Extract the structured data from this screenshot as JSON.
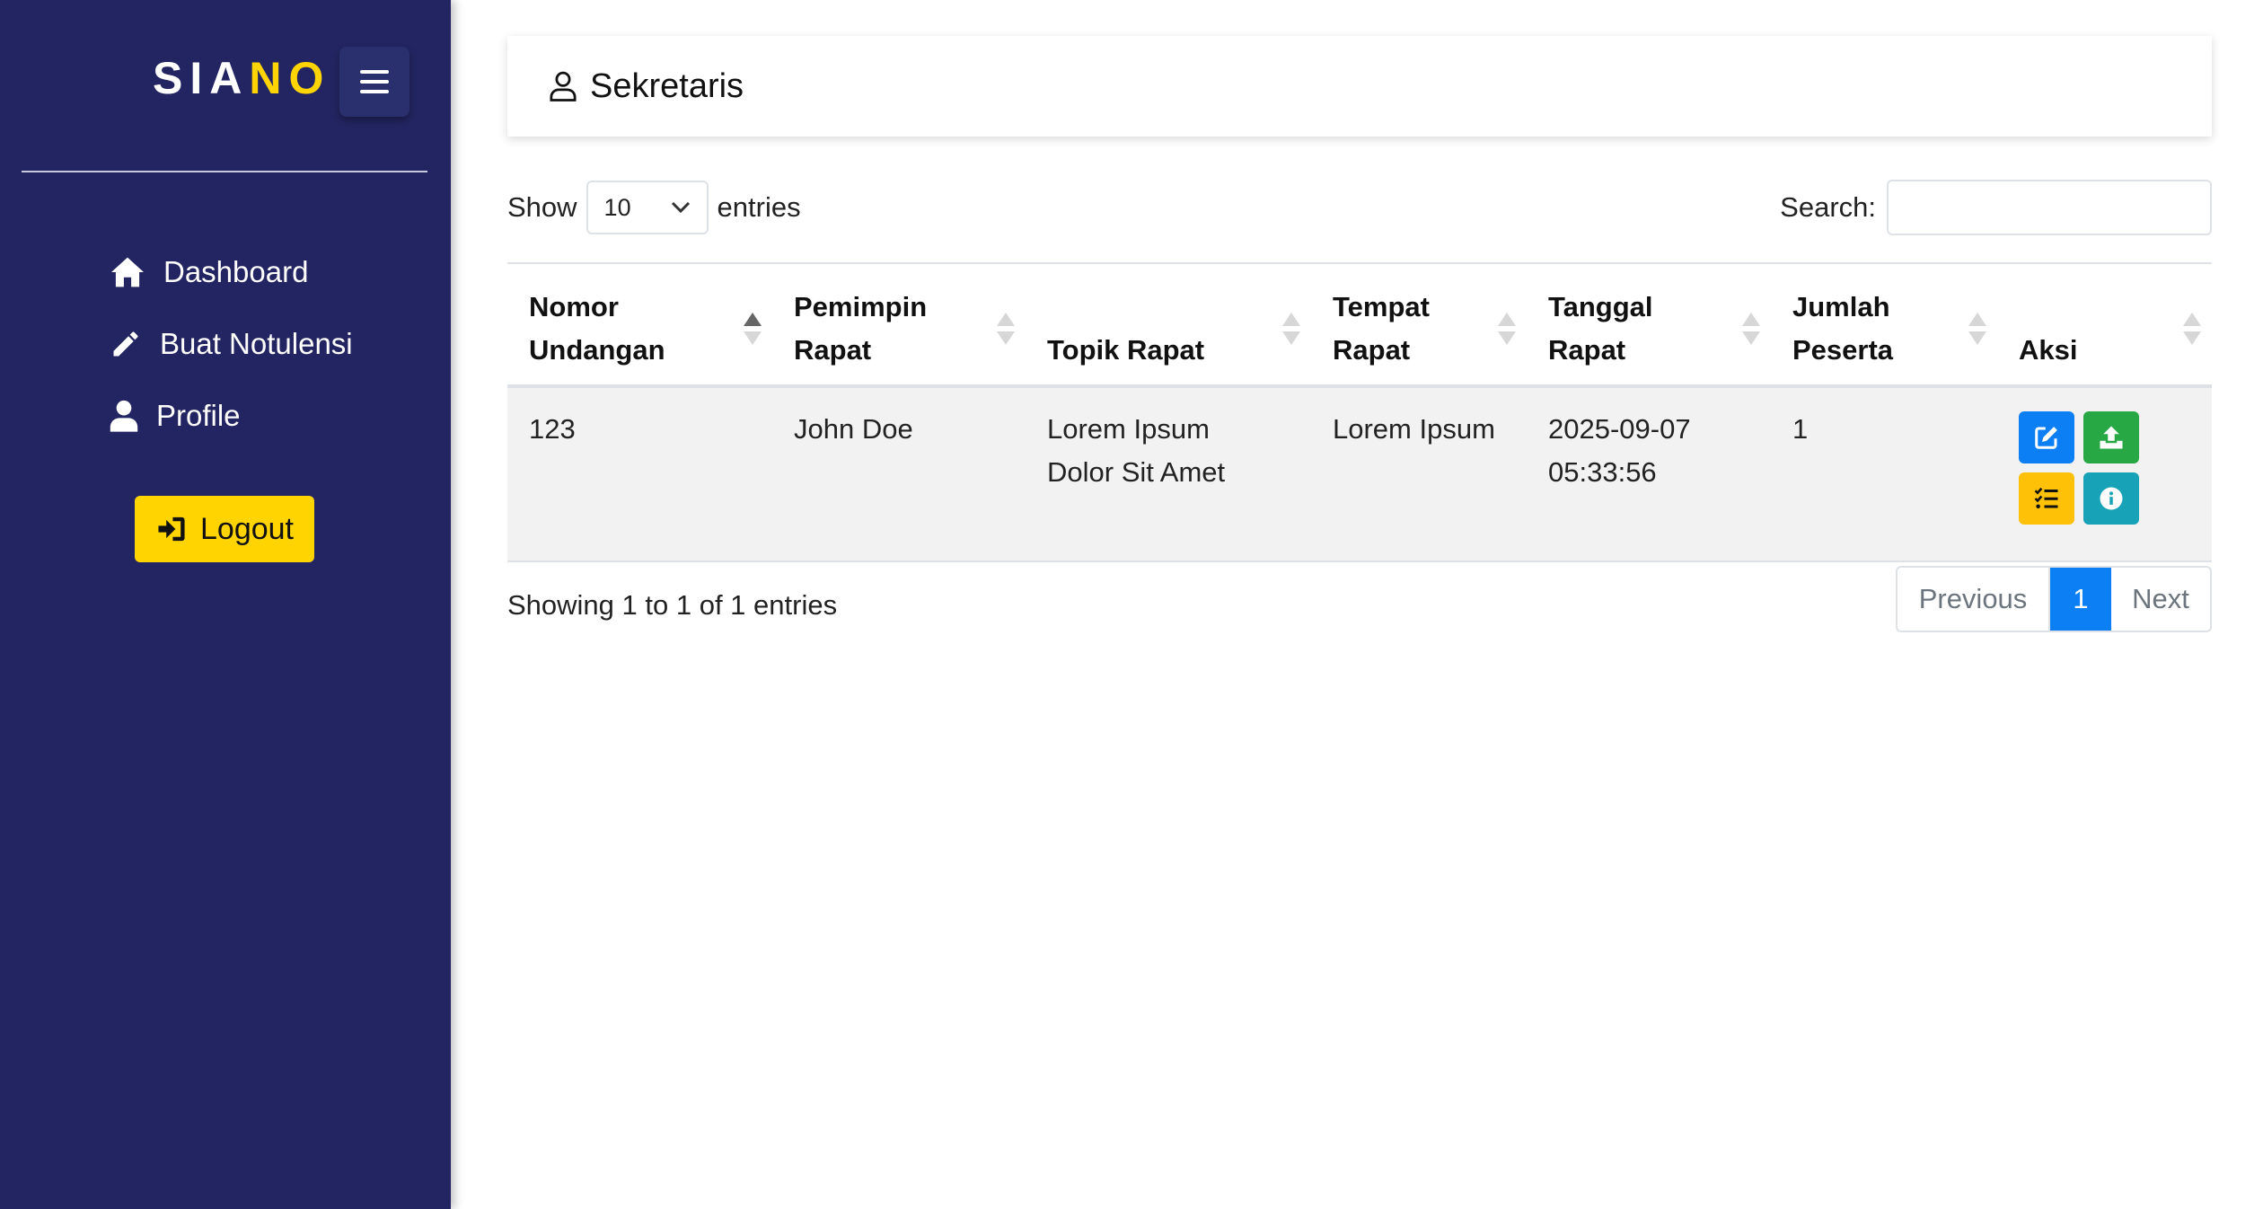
{
  "brand": {
    "prefix": "SIA",
    "accent": "NO"
  },
  "sidebar": {
    "items": [
      {
        "label": "Dashboard",
        "icon": "home-icon"
      },
      {
        "label": "Buat Notulensi",
        "icon": "pencil-icon"
      },
      {
        "label": "Profile",
        "icon": "user-icon"
      }
    ],
    "logout_label": "Logout"
  },
  "header": {
    "title": "Sekretaris",
    "icon": "user-outline-icon"
  },
  "length_menu": {
    "show_label": "Show",
    "selected": "10",
    "entries_label": "entries"
  },
  "search": {
    "label": "Search:",
    "value": ""
  },
  "table": {
    "columns": [
      {
        "line1": "Nomor",
        "line2": "Undangan"
      },
      {
        "line1": "Pemimpin",
        "line2": "Rapat"
      },
      {
        "line1": "",
        "line2": "Topik Rapat"
      },
      {
        "line1": "Tempat",
        "line2": "Rapat"
      },
      {
        "line1": "Tanggal",
        "line2": "Rapat"
      },
      {
        "line1": "Jumlah",
        "line2": "Peserta"
      },
      {
        "line1": "",
        "line2": "Aksi"
      }
    ],
    "rows": [
      {
        "nomor": "123",
        "pemimpin": "John Doe",
        "topik_line1": "Lorem Ipsum",
        "topik_line2": "Dolor Sit Amet",
        "tempat": "Lorem Ipsum",
        "tanggal_date": "2025-09-07",
        "tanggal_time": "05:33:56",
        "jumlah": "1"
      }
    ]
  },
  "info": "Showing 1 to 1 of 1 entries",
  "pagination": {
    "previous": "Previous",
    "current": "1",
    "next": "Next"
  },
  "colors": {
    "sidebar_bg": "#232562",
    "brand_accent": "#ffd400",
    "edit_button": "#0d7ff5",
    "upload_button": "#28a745",
    "list_button": "#ffc107",
    "info_button": "#17a2b8"
  }
}
